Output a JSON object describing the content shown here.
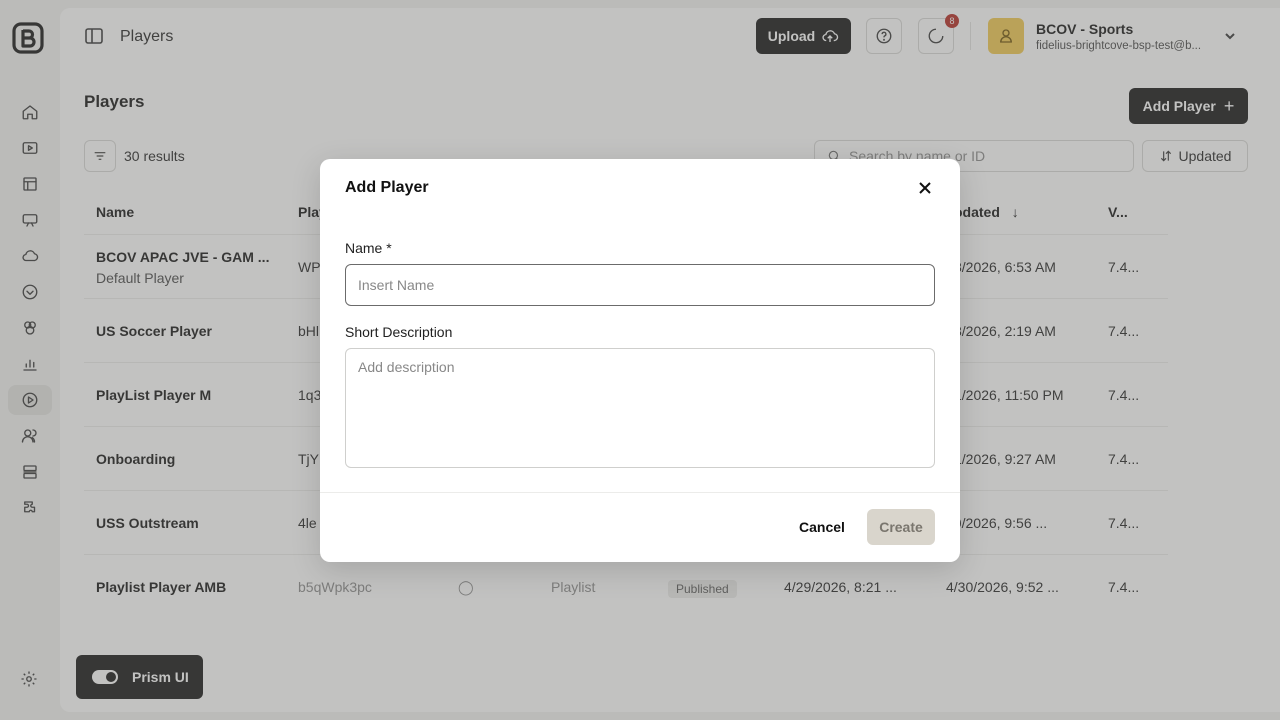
{
  "topbar": {
    "title": "Players",
    "upload_label": "Upload",
    "notifications_count": "8",
    "account_name": "BCOV - Sports",
    "account_email": "fidelius-brightcove-bsp-test@b..."
  },
  "page": {
    "title": "Players",
    "add_button": "Add Player",
    "results": "30 results",
    "search_placeholder": "Search by name or ID",
    "sort_label": "Updated"
  },
  "table": {
    "headers": {
      "name": "Name",
      "player_id": "Play",
      "updated": "odated",
      "version": "V..."
    },
    "rows": [
      {
        "name": "BCOV APAC JVE - GAM ...",
        "sub": "Default Player",
        "id": "WP",
        "updated": "8/2026, 6:53 AM",
        "version": "7.4..."
      },
      {
        "name": "US Soccer Player",
        "sub": "",
        "id": "bHl",
        "updated": "8/2026, 2:19 AM",
        "version": "7.4..."
      },
      {
        "name": "PlayList Player M",
        "sub": "",
        "id": "1q3",
        "updated": "1/2026, 11:50 PM",
        "version": "7.4..."
      },
      {
        "name": "Onboarding",
        "sub": "",
        "id": "TjY",
        "updated": "1/2026, 9:27 AM",
        "version": "7.4..."
      },
      {
        "name": "USS Outstream",
        "sub": "",
        "id": "4le",
        "updated": "30/2026, 9:56 ...",
        "version": "7.4..."
      },
      {
        "name": "Playlist Player AMB",
        "sub": "",
        "id": "b5qWpk3pc",
        "type": "Playlist",
        "status": "Published",
        "created": "4/29/2026, 8:21 ...",
        "updated": "4/30/2026, 9:52 ...",
        "version": "7.4..."
      }
    ]
  },
  "footer": {
    "prism_label": "Prism UI"
  },
  "modal": {
    "title": "Add Player",
    "name_label": "Name *",
    "name_placeholder": "Insert Name",
    "desc_label": "Short Description",
    "desc_placeholder": "Add description",
    "cancel_label": "Cancel",
    "create_label": "Create"
  },
  "colors": {
    "overlay": "#6e6e6c",
    "primary_button": "#111111",
    "avatar": "#f2c94c",
    "badge": "#b3261e",
    "create_disabled": "#d9d5cc"
  }
}
